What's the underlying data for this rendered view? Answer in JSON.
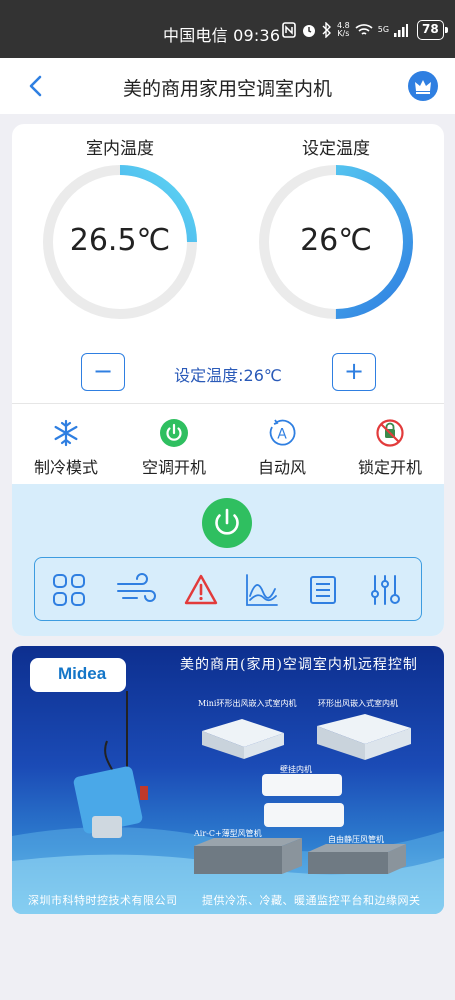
{
  "status_bar": {
    "carrier_time": "中国电信 09:36",
    "net_speed_value": "4.8",
    "net_speed_unit": "K/s",
    "signal_label": "5G",
    "battery": "78"
  },
  "nav": {
    "title": "美的商用家用空调室内机"
  },
  "gauges": {
    "indoor": {
      "label": "室内温度",
      "value": "26.5℃",
      "fill_fraction": 0.25
    },
    "setpoint": {
      "label": "设定温度",
      "value": "26℃",
      "fill_fraction": 0.5
    }
  },
  "setpoint_control": {
    "minus_label": "−",
    "plus_label": "+",
    "text": "设定温度:26℃"
  },
  "modes": [
    {
      "label": "制冷模式",
      "icon": "snowflake-icon"
    },
    {
      "label": "空调开机",
      "icon": "power-on-icon"
    },
    {
      "label": "自动风",
      "icon": "auto-fan-icon"
    },
    {
      "label": "锁定开机",
      "icon": "lock-disabled-icon"
    }
  ],
  "toolbar_icons": [
    "grid-icon",
    "wind-icon",
    "warning-icon",
    "curve-chart-icon",
    "list-icon",
    "sliders-icon"
  ],
  "colors": {
    "accent": "#2f7fe1",
    "gauge_start": "#2f7fe1",
    "gauge_end": "#5fd8f4",
    "power_green": "#2fbf60",
    "warning_red": "#e23b3b",
    "panel_bg": "#d7edfb"
  },
  "banner": {
    "logo": "Midea",
    "title": "美的商用(家用)空调室内机远程控制",
    "products": [
      "Mini环形出风嵌入式室内机",
      "环形出风嵌入式室内机",
      "壁挂内机",
      "Air-C+薄型风管机",
      "自由静压风管机"
    ],
    "company": "深圳市科特时控技术有限公司",
    "slogan": "提供冷冻、冷藏、暖通监控平台和边缘网关"
  }
}
